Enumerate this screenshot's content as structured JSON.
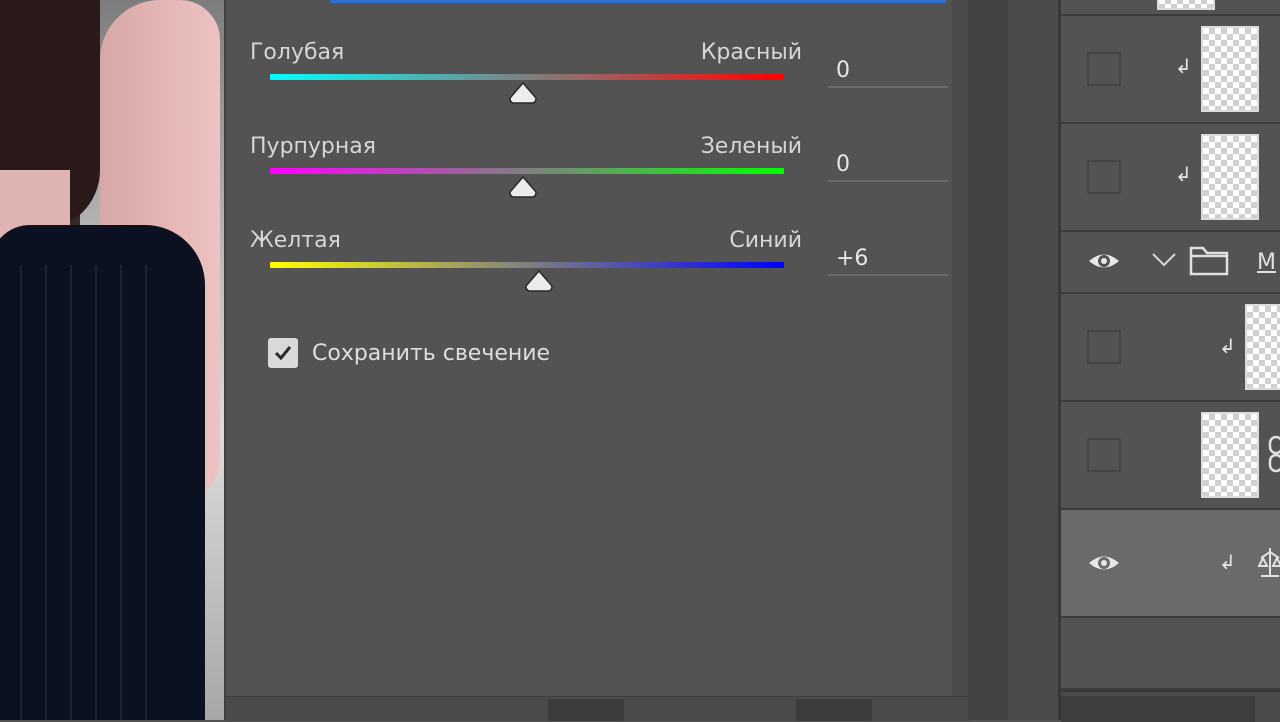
{
  "properties": {
    "sliders": [
      {
        "left_label": "Голубая",
        "right_label": "Красный",
        "value": "0",
        "position": 0.5,
        "gradient": [
          "#00ffff",
          "#ff0000"
        ]
      },
      {
        "left_label": "Пурпурная",
        "right_label": "Зеленый",
        "value": "0",
        "position": 0.5,
        "gradient": [
          "#ff00ff",
          "#00ff00"
        ]
      },
      {
        "left_label": "Желтая",
        "right_label": "Синий",
        "value": "+6",
        "position": 0.53,
        "gradient": [
          "#ffff00",
          "#0000ff"
        ]
      }
    ],
    "preserve_luminosity": {
      "label": "Сохранить свечение",
      "checked": true
    }
  },
  "layers": {
    "group_name": "М",
    "items": [
      {
        "type": "layer",
        "visible": false,
        "clipped": true
      },
      {
        "type": "layer",
        "visible": false,
        "clipped": true
      },
      {
        "type": "group",
        "visible": true,
        "expanded": true
      },
      {
        "type": "layer",
        "visible": false,
        "clipped": true
      },
      {
        "type": "layer",
        "visible": false,
        "clipped": false,
        "linked": true
      },
      {
        "type": "adjustment",
        "visible": true,
        "clipped": true,
        "selected": true
      }
    ]
  },
  "colors": {
    "panel_bg": "#535353",
    "accent": "#2d6fd1"
  }
}
